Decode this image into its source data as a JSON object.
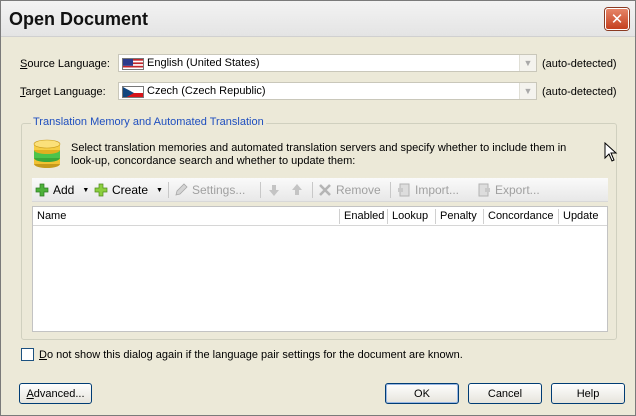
{
  "window": {
    "title": "Open Document",
    "close_label": "✕"
  },
  "source": {
    "label_key": "S",
    "label_rest": "ource Language:",
    "value": "English (United States)",
    "note": "(auto-detected)",
    "flag": "us-flag"
  },
  "target": {
    "label_key": "T",
    "label_rest": "arget Language:",
    "value": "Czech (Czech Republic)",
    "note": "(auto-detected)",
    "flag": "czech-flag"
  },
  "tm_group": {
    "title": "Translation Memory and Automated Translation",
    "description": "Select translation memories and automated translation servers and specify whether to include them in look-up, concordance search and whether to update them:"
  },
  "toolbar": {
    "add": "Add",
    "create": "Create",
    "settings": "Settings...",
    "remove": "Remove",
    "import": "Import...",
    "export": "Export..."
  },
  "grid": {
    "columns": [
      "Name",
      "Enabled",
      "Lookup",
      "Penalty",
      "Concordance",
      "Update"
    ],
    "rows": []
  },
  "dont_show": {
    "key": "D",
    "rest": "o not show this dialog again if the language pair settings for the document are known.",
    "checked": false
  },
  "buttons": {
    "advanced_key": "A",
    "advanced_rest": "dvanced...",
    "ok": "OK",
    "cancel": "Cancel",
    "help": "Help"
  },
  "colors": {
    "group_title": "#1f4fbf",
    "close_button": "#c4401f"
  }
}
